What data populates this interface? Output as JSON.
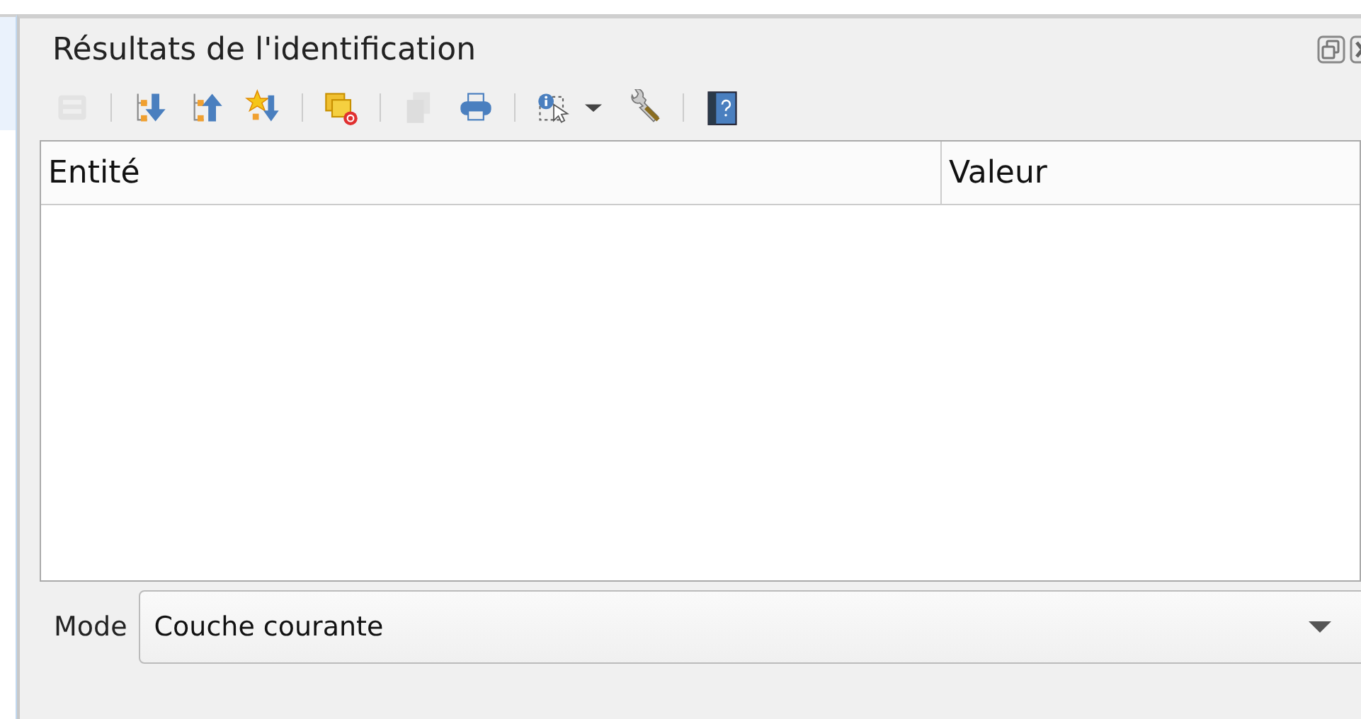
{
  "panel": {
    "title": "Résultats de l'identification"
  },
  "toolbar": [
    {
      "kind": "expand-tree",
      "disabled": true
    },
    {
      "kind": "separator"
    },
    {
      "kind": "expand",
      "disabled": false
    },
    {
      "kind": "collapse",
      "disabled": false
    },
    {
      "kind": "expand-new",
      "disabled": false
    },
    {
      "kind": "separator"
    },
    {
      "kind": "clear-highlight",
      "disabled": false
    },
    {
      "kind": "separator"
    },
    {
      "kind": "copy",
      "disabled": true
    },
    {
      "kind": "print",
      "disabled": false
    },
    {
      "kind": "separator"
    },
    {
      "kind": "identify-selection",
      "disabled": false
    },
    {
      "kind": "dropdown",
      "disabled": false
    },
    {
      "kind": "settings",
      "disabled": false
    },
    {
      "kind": "separator"
    },
    {
      "kind": "help",
      "disabled": false
    }
  ],
  "table": {
    "columns": [
      "Entité",
      "Valeur"
    ]
  },
  "mode": {
    "label": "Mode",
    "value": "Couche courante"
  }
}
